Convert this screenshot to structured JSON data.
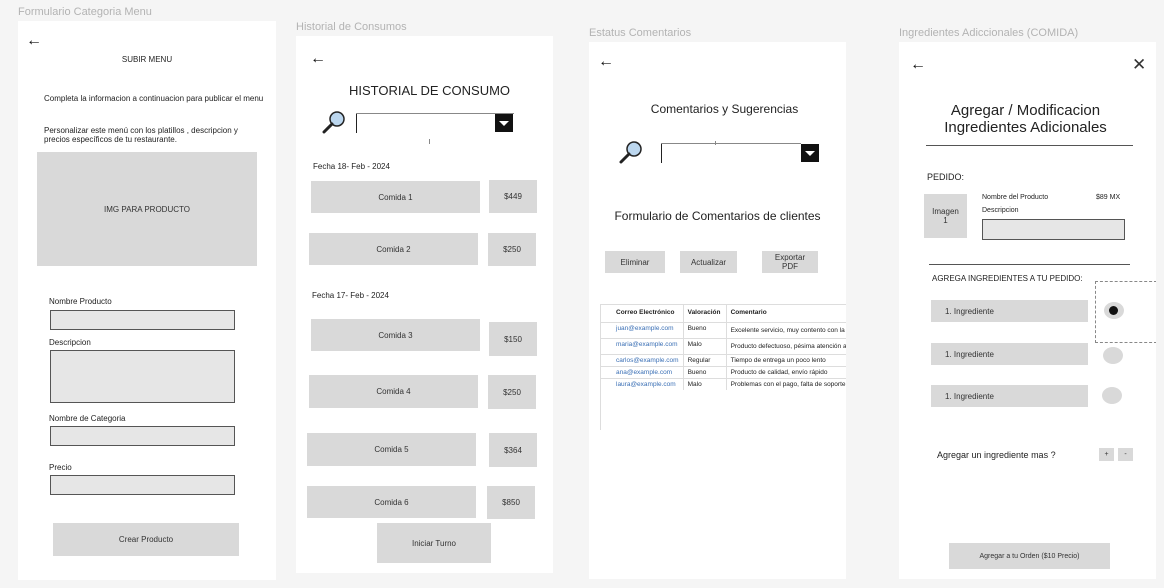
{
  "frames": {
    "f1": {
      "label": "Formulario Categoria Menu"
    },
    "f2": {
      "label": "Historial de Consumos"
    },
    "f3": {
      "label": "Estatus Comentarios"
    },
    "f4": {
      "label": "Ingredientes Adiccionales (COMIDA)"
    }
  },
  "icons": {
    "back": "←",
    "close": "✕"
  },
  "subir_menu": {
    "title": "SUBIR MENU",
    "intro": "Completa la informacion a continuacion para publicar el menu",
    "desc": "Personalizar este menú con los platillos , descripcion y precios específicos de tu restaurante.",
    "image_placeholder": "IMG PARA PRODUCTO",
    "fields": {
      "nombre_producto": "Nombre Producto",
      "descripcion": "Descripcion",
      "nombre_categoria": "Nombre de Categoria",
      "precio": "Precio"
    },
    "submit": "Crear Producto"
  },
  "historial": {
    "title": "HISTORIAL DE CONSUMO",
    "date1": "Fecha 18- Feb - 2024",
    "date2": "Fecha 17- Feb - 2024",
    "items": [
      {
        "name": "Comida 1",
        "price": "$449"
      },
      {
        "name": "Comida 2",
        "price": "$250"
      },
      {
        "name": "Comida 3",
        "price": "$150"
      },
      {
        "name": "Comida 4",
        "price": "$250"
      },
      {
        "name": "Comida 5",
        "price": "$364"
      },
      {
        "name": "Comida 6",
        "price": "$850"
      }
    ],
    "start": "Iniciar Turno"
  },
  "comentarios": {
    "title": "Comentarios y Sugerencias",
    "form_title": "Formulario de Comentarios de clientes",
    "buttons": {
      "eliminar": "Eliminar",
      "actualizar": "Actualizar",
      "exportar_1": "Exportar",
      "exportar_2": "PDF"
    },
    "table": {
      "headers": [
        "Correo Electrónico",
        "Valoración",
        "Comentario"
      ],
      "rows": [
        {
          "email": "juan@example.com",
          "rating": "Bueno",
          "comment": "Excelente servicio, muy contento con la compra"
        },
        {
          "email": "maria@example.com",
          "rating": "Malo",
          "comment": "Producto defectuoso, pésima atención al cliente"
        },
        {
          "email": "carlos@example.com",
          "rating": "Regular",
          "comment": "Tiempo de entrega un poco lento"
        },
        {
          "email": "ana@example.com",
          "rating": "Bueno",
          "comment": "Producto de calidad, envío rápido"
        },
        {
          "email": "laura@example.com",
          "rating": "Malo",
          "comment": "Problemas con el pago, falta de soporte"
        }
      ]
    }
  },
  "ingredientes": {
    "title_1": "Agregar / Modificacion",
    "title_2": "Ingredientes Adicionales",
    "pedido": "PEDIDO:",
    "image_1": "Imagen",
    "image_2": "1",
    "product_name": "Nombre del Producto",
    "product_price": "$89 MX",
    "description": "Descripcion",
    "agrega": "AGREGA INGREDIENTES A TU PEDIDO:",
    "ingredients": [
      "1. Ingrediente",
      "1. Ingrediente",
      "1. Ingrediente"
    ],
    "add_more": "Agregar un ingrediente mas ?",
    "plus": "+",
    "minus": "-",
    "order_button": "Agregar a tu Orden ($10 Precio)"
  }
}
